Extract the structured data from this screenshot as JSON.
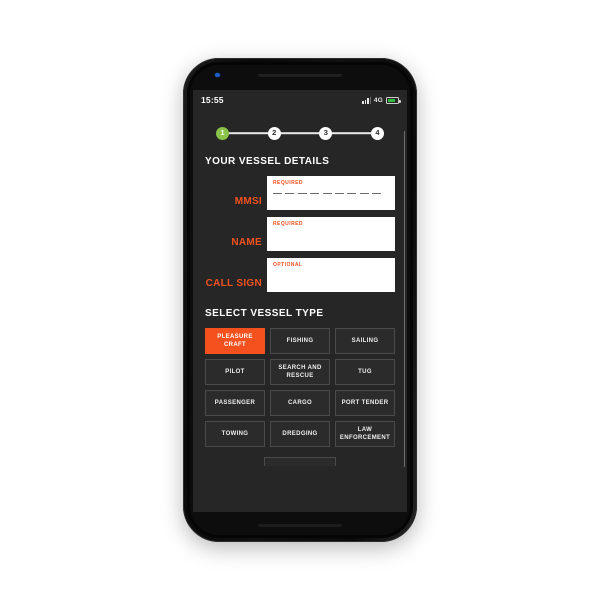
{
  "device": {
    "name": "smartphone-mockup",
    "camera_icon": "camera-dot-icon",
    "speaker_icon": "speaker-grille-icon"
  },
  "status_bar": {
    "time": "15:55",
    "network": "4G",
    "signal_icon": "signal-bars-icon",
    "battery_icon": "battery-icon",
    "battery_level": 78
  },
  "stepper": {
    "steps": [
      {
        "label": "1",
        "state": "active"
      },
      {
        "label": "2",
        "state": "inactive"
      },
      {
        "label": "3",
        "state": "inactive"
      },
      {
        "label": "4",
        "state": "inactive"
      }
    ]
  },
  "vessel_details": {
    "heading": "YOUR VESSEL DETAILS",
    "fields": [
      {
        "label": "MMSI",
        "tag": "REQUIRED",
        "value": "",
        "digits": 9
      },
      {
        "label": "NAME",
        "tag": "REQUIRED",
        "value": "",
        "digits": 0
      },
      {
        "label": "CALL SIGN",
        "tag": "OPTIONAL",
        "value": "",
        "digits": 0
      }
    ]
  },
  "vessel_type": {
    "heading": "SELECT VESSEL TYPE",
    "selected": "PLEASURE CRAFT",
    "options": [
      "PLEASURE CRAFT",
      "FISHING",
      "SAILING",
      "PILOT",
      "SEARCH AND RESCUE",
      "TUG",
      "PASSENGER",
      "CARGO",
      "PORT TENDER",
      "TOWING",
      "DREDGING",
      "LAW ENFORCEMENT"
    ]
  },
  "colors": {
    "accent_orange": "#F4511E",
    "active_green": "#8BC34A",
    "screen_bg": "#262626",
    "field_bg": "#FFFFFF",
    "battery_green": "#2FBF3F"
  }
}
